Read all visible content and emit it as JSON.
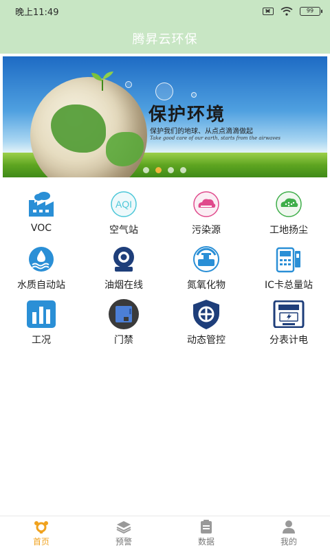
{
  "status": {
    "time": "晚上11:49",
    "battery": "99"
  },
  "app": {
    "title": "腾昇云环保"
  },
  "banner": {
    "headline": "保护环境",
    "subline": "保护我们的地球、从点点滴滴做起",
    "english": "Take good care of our earth, starts from the airwaves",
    "active_dot": 1
  },
  "modules": [
    {
      "label": "VOC",
      "icon": "factory-icon"
    },
    {
      "label": "空气站",
      "icon": "aqi-icon"
    },
    {
      "label": "污染源",
      "icon": "pollution-cloud-icon"
    },
    {
      "label": "工地扬尘",
      "icon": "construction-dust-icon"
    },
    {
      "label": "水质自动站",
      "icon": "water-drop-icon"
    },
    {
      "label": "油烟在线",
      "icon": "fume-camera-icon"
    },
    {
      "label": "氮氧化物",
      "icon": "nox-valve-icon"
    },
    {
      "label": "IC卡总量站",
      "icon": "ic-card-icon"
    },
    {
      "label": "工况",
      "icon": "bar-chart-icon"
    },
    {
      "label": "门禁",
      "icon": "access-control-icon"
    },
    {
      "label": "动态管控",
      "icon": "shield-icon"
    },
    {
      "label": "分表计电",
      "icon": "electric-meter-icon"
    }
  ],
  "nav": [
    {
      "label": "首页",
      "icon": "home-icon",
      "active": true
    },
    {
      "label": "预警",
      "icon": "layers-icon",
      "active": false
    },
    {
      "label": "数据",
      "icon": "clipboard-icon",
      "active": false
    },
    {
      "label": "我的",
      "icon": "user-icon",
      "active": false
    }
  ],
  "colors": {
    "header": "#c8e6c4",
    "accent": "#f0a21e",
    "icon_blue": "#2a8fd6"
  }
}
